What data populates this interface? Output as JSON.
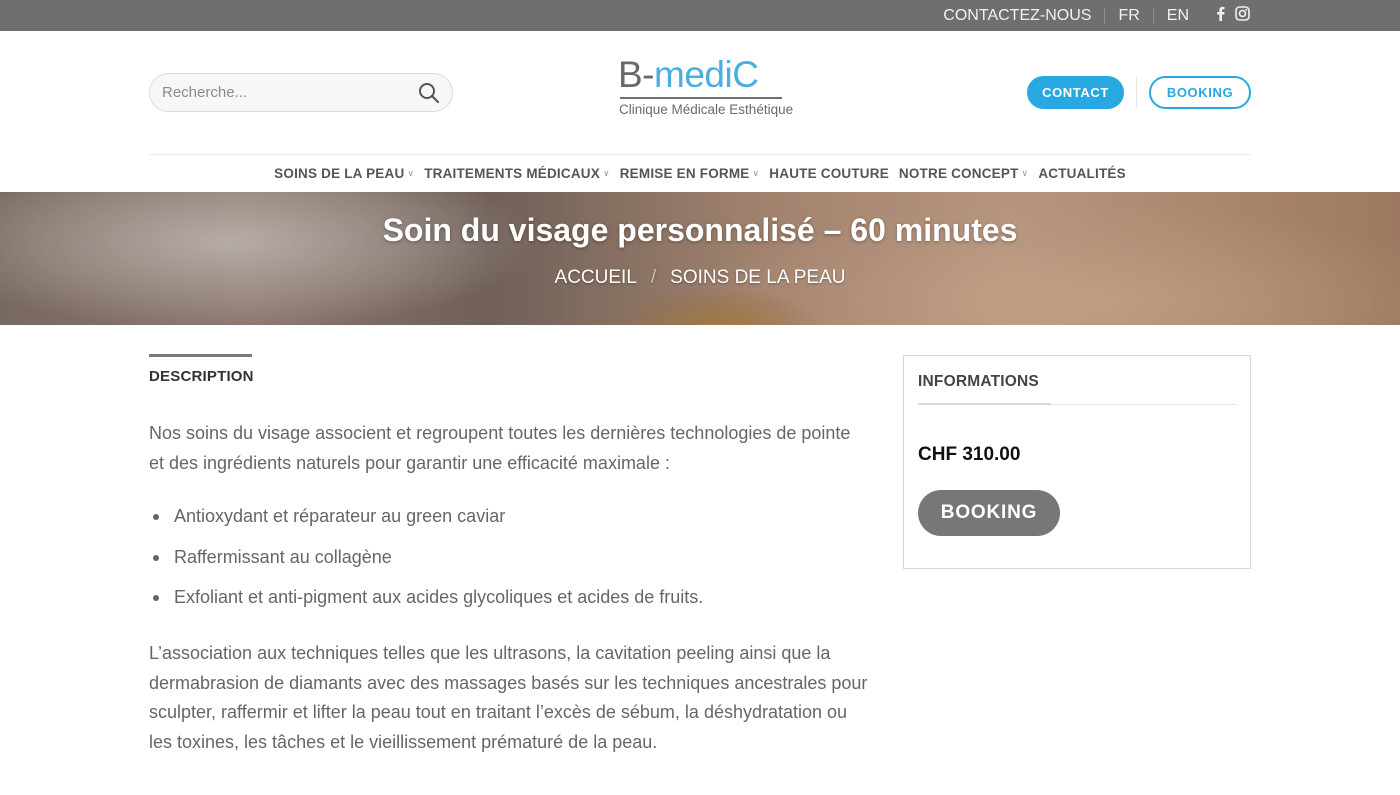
{
  "topbar": {
    "contact": "CONTACTEZ-NOUS",
    "lang_fr": "FR",
    "lang_en": "EN",
    "social": [
      "facebook-icon",
      "instagram-icon"
    ]
  },
  "header": {
    "search_placeholder": "Recherche...",
    "logo_part1": "B-",
    "logo_part2": "mediC",
    "logo_sub": "Clinique Médicale Esthétique",
    "contact_btn": "CONTACT",
    "booking_btn": "BOOKING"
  },
  "nav": {
    "items": [
      {
        "label": "SOINS DE LA PEAU",
        "dropdown": true
      },
      {
        "label": "TRAITEMENTS MÉDICAUX",
        "dropdown": true
      },
      {
        "label": "REMISE EN FORME",
        "dropdown": true
      },
      {
        "label": "HAUTE COUTURE",
        "dropdown": false
      },
      {
        "label": "NOTRE CONCEPT",
        "dropdown": true
      },
      {
        "label": "ACTUALITÉS",
        "dropdown": false
      }
    ]
  },
  "hero": {
    "title": "Soin du visage personnalisé – 60 minutes",
    "crumbs": [
      "ACCUEIL",
      "SOINS DE LA PEAU"
    ],
    "crumb_divider": "/"
  },
  "content": {
    "tab": "DESCRIPTION",
    "intro": "Nos soins du visage associent et regroupent toutes les dernières technologies de pointe et des ingrédients naturels pour garantir une efficacité maximale :",
    "bullets": [
      "Antioxydant et réparateur au green caviar",
      "Raffermissant au collagène",
      "Exfoliant et anti-pigment aux acides glycoliques et acides de fruits."
    ],
    "outro": "L’association aux techniques telles que les ultrasons, la cavitation peeling ainsi que la dermabrasion de diamants avec des massages basés sur les techniques ancestrales pour sculpter, raffermir et lifter la peau tout en traitant l’excès de sébum, la déshydratation ou les toxines, les tâches et le vieillissement prématuré de la peau."
  },
  "sidebar": {
    "heading": "INFORMATIONS",
    "price": "CHF 310.00",
    "booking": "BOOKING"
  },
  "colors": {
    "topbar": "#6f6f6f",
    "accent": "#27a8e0",
    "logo_blue": "#4aaee0",
    "booking_gray": "#777777"
  }
}
